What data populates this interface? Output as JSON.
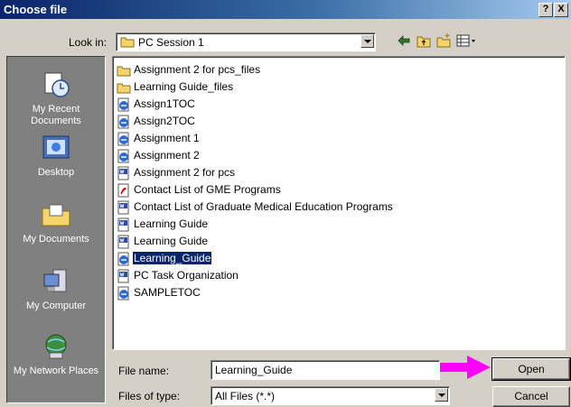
{
  "window": {
    "title": "Choose file",
    "help_btn": "?",
    "close_btn": "X"
  },
  "toolbar": {
    "look_in_label": "Look in:",
    "look_in_value": "PC Session 1",
    "icons": [
      "back-arrow-icon",
      "up-folder-icon",
      "new-folder-icon",
      "views-menu-icon"
    ]
  },
  "places": [
    {
      "label": "My Recent Documents",
      "icon": "recent-documents-icon"
    },
    {
      "label": "Desktop",
      "icon": "desktop-icon"
    },
    {
      "label": "My Documents",
      "icon": "my-documents-icon"
    },
    {
      "label": "My Computer",
      "icon": "my-computer-icon"
    },
    {
      "label": "My Network Places",
      "icon": "network-places-icon"
    }
  ],
  "files": [
    {
      "name": "Assignment 2 for pcs_files",
      "type": "folder"
    },
    {
      "name": "Learning Guide_files",
      "type": "folder"
    },
    {
      "name": "Assign1TOC",
      "type": "ie"
    },
    {
      "name": "Assign2TOC",
      "type": "ie"
    },
    {
      "name": "Assignment 1",
      "type": "ie"
    },
    {
      "name": "Assignment 2",
      "type": "ie"
    },
    {
      "name": "Assignment 2 for pcs",
      "type": "word"
    },
    {
      "name": "Contact List of GME Programs",
      "type": "pdf"
    },
    {
      "name": "Contact List of Graduate Medical Education Programs",
      "type": "word"
    },
    {
      "name": "Learning Guide",
      "type": "word"
    },
    {
      "name": "Learning Guide",
      "type": "word"
    },
    {
      "name": "Learning_Guide",
      "type": "ie",
      "selected": true
    },
    {
      "name": "PC Task Organization",
      "type": "word"
    },
    {
      "name": "SAMPLETOC",
      "type": "ie"
    }
  ],
  "form": {
    "file_name_label": "File name:",
    "file_name_value": "Learning_Guide",
    "files_of_type_label": "Files of type:",
    "files_of_type_value": "All Files (*.*)",
    "open_label": "Open",
    "cancel_label": "Cancel"
  },
  "colors": {
    "selection": "#0a246a",
    "pointer": "#ff00ff",
    "titlebar": "#0a246a"
  }
}
